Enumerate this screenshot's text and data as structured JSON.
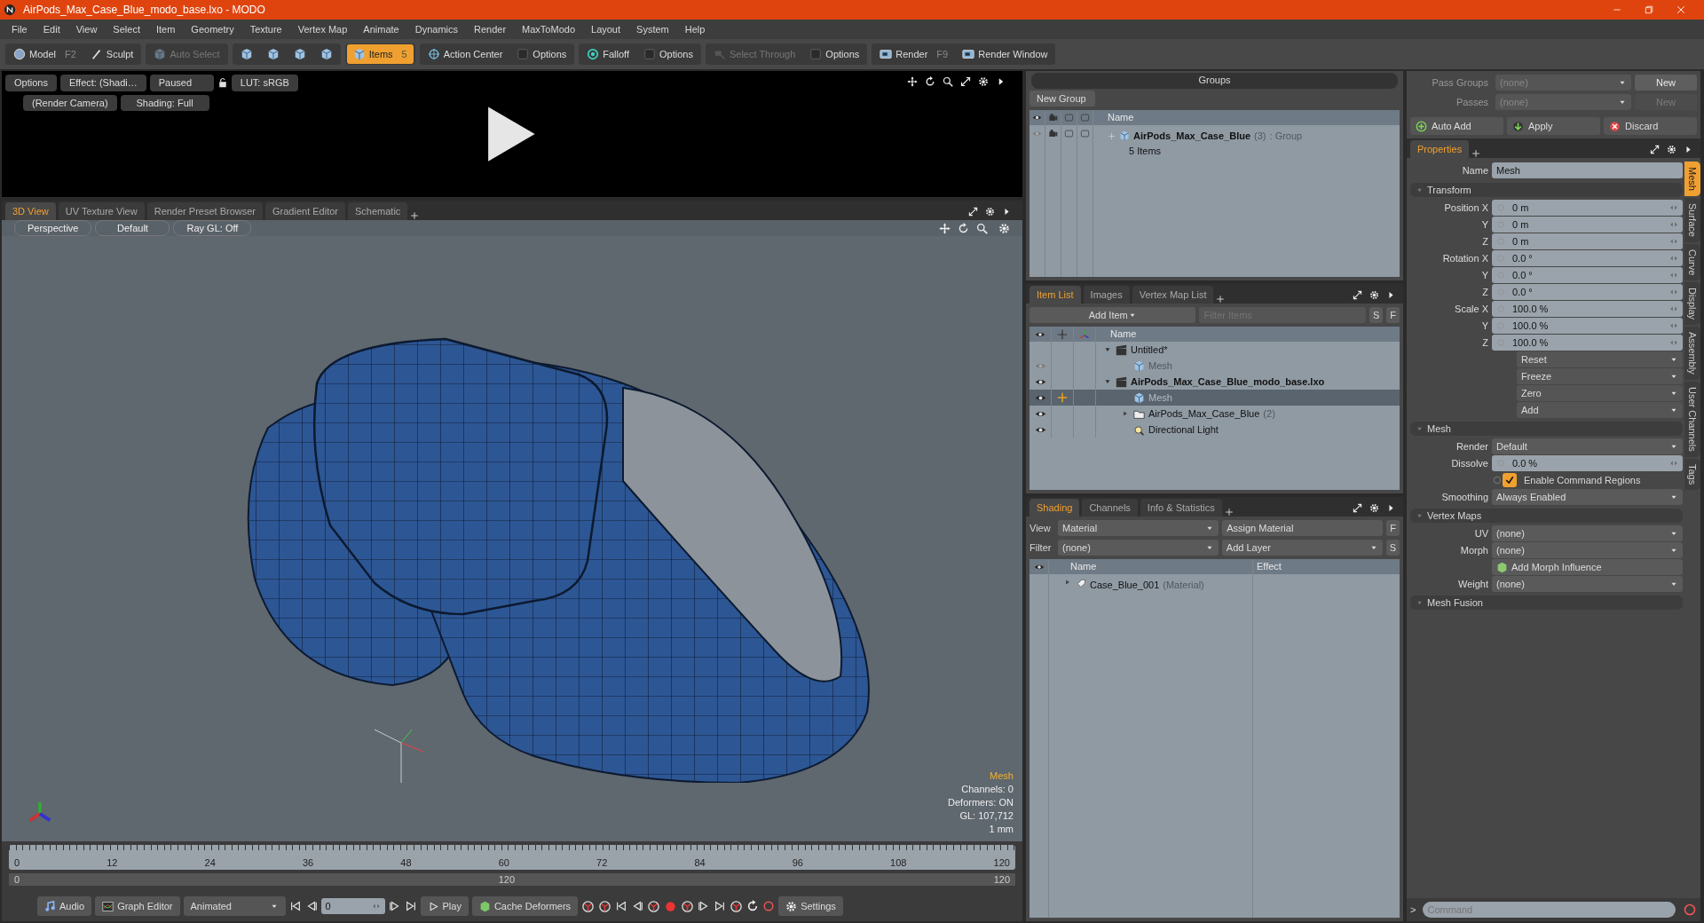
{
  "window": {
    "title": "AirPods_Max_Case_Blue_modo_base.lxo - MODO"
  },
  "menu": [
    "File",
    "Edit",
    "View",
    "Select",
    "Item",
    "Geometry",
    "Texture",
    "Vertex Map",
    "Animate",
    "Dynamics",
    "Render",
    "MaxToModo",
    "Layout",
    "System",
    "Help"
  ],
  "toolbar": [
    [
      {
        "kind": "sphere",
        "label": "Model",
        "shortcut": "F2",
        "selected": false,
        "disabled": false
      },
      {
        "kind": "brush",
        "label": "Sculpt",
        "selected": false,
        "disabled": false
      }
    ],
    [
      {
        "kind": "cube",
        "label": "Auto Select",
        "selected": false,
        "disabled": true
      }
    ],
    [
      {
        "kind": "cube",
        "selected": false,
        "disabled": false
      },
      {
        "kind": "cube",
        "selected": false,
        "disabled": false
      },
      {
        "kind": "cube",
        "selected": false,
        "disabled": false
      },
      {
        "kind": "cube",
        "selected": false,
        "disabled": false
      }
    ],
    [
      {
        "kind": "cube",
        "label": "Items",
        "shortcut": "5",
        "selected": true,
        "disabled": false
      }
    ],
    [
      {
        "kind": "target",
        "label": "Action Center",
        "selected": false,
        "disabled": false
      },
      {
        "kind": "check",
        "label": "Options",
        "selected": false,
        "disabled": false
      }
    ],
    [
      {
        "kind": "ring",
        "label": "Falloff",
        "selected": false,
        "disabled": false
      },
      {
        "kind": "check",
        "label": "Options",
        "selected": false,
        "disabled": false
      }
    ],
    [
      {
        "kind": "select",
        "label": "Select Through",
        "selected": false,
        "disabled": true
      },
      {
        "kind": "check",
        "label": "Options",
        "selected": false,
        "disabled": false
      }
    ],
    [
      {
        "kind": "render",
        "label": "Render",
        "shortcut": "F9",
        "selected": false,
        "disabled": false
      },
      {
        "kind": "render",
        "label": "Render Window",
        "selected": false,
        "disabled": false
      }
    ]
  ],
  "preview": {
    "row1": [
      "Options",
      "Effect: (Shadi…",
      "Paused",
      "LUT: sRGB"
    ],
    "row2": [
      "(Render Camera)",
      "Shading: Full"
    ]
  },
  "viewport": {
    "tabs": [
      {
        "label": "3D View",
        "selected": true
      },
      {
        "label": "UV Texture View",
        "selected": false
      },
      {
        "label": "Render Preset Browser",
        "selected": false
      },
      {
        "label": "Gradient Editor",
        "selected": false
      },
      {
        "label": "Schematic",
        "selected": false
      }
    ],
    "buttons": [
      "Perspective",
      "Default",
      "Ray GL: Off"
    ],
    "info_title": "Mesh",
    "info": [
      "Channels: 0",
      "Deformers: ON",
      "GL: 107,712",
      "1 mm"
    ]
  },
  "timeline": {
    "ticks": [
      "0",
      "12",
      "24",
      "36",
      "48",
      "60",
      "72",
      "84",
      "96",
      "108",
      "120"
    ],
    "range": [
      "0",
      "120",
      "120"
    ]
  },
  "transport": {
    "audio": "Audio",
    "graph_editor": "Graph Editor",
    "mode": "Animated",
    "frame": "0",
    "play": "Play",
    "cache": "Cache Deformers",
    "settings": "Settings"
  },
  "groups": {
    "title": "Groups",
    "new_button": "New Group",
    "column": "Name",
    "rows": [
      {
        "name": "AirPods_Max_Case_Blue",
        "count": "(3)",
        "type": ": Group",
        "detail": "5 Items"
      }
    ]
  },
  "passes": {
    "rows": [
      {
        "label": "Pass Groups",
        "value": "(none)",
        "button": "New",
        "disabled": false
      },
      {
        "label": "Passes",
        "value": "(none)",
        "button": "New",
        "disabled": true
      }
    ],
    "actions": [
      "Auto Add",
      "Apply",
      "Discard"
    ]
  },
  "item_list": {
    "tabs": [
      {
        "label": "Item List",
        "selected": true
      },
      {
        "label": "Images",
        "selected": false
      },
      {
        "label": "Vertex Map List",
        "selected": false
      }
    ],
    "add_button": "Add Item",
    "filter_placeholder": "Filter Items",
    "s_button": "S",
    "f_button": "F",
    "column": "Name",
    "items": [
      {
        "kind": "scene",
        "name": "Untitled*",
        "current": false,
        "greyed": false,
        "selected": false,
        "expanded": true,
        "children": [
          {
            "kind": "mesh",
            "name": "Mesh",
            "visible": false,
            "current": false,
            "greyed": true,
            "selected": false
          }
        ]
      },
      {
        "kind": "scene",
        "name": "AirPods_Max_Case_Blue_modo_base.lxo",
        "visible": true,
        "current": true,
        "greyed": false,
        "selected": false,
        "expanded": true,
        "children": [
          {
            "kind": "mesh",
            "name": "Mesh",
            "visible": true,
            "current": false,
            "greyed": true,
            "selected": true
          },
          {
            "kind": "group",
            "name": "AirPods_Max_Case_Blue",
            "count": "(2)",
            "visible": true,
            "current": false,
            "greyed": false,
            "selected": false,
            "expanded": false
          },
          {
            "kind": "light",
            "name": "Directional Light",
            "visible": true,
            "current": false,
            "greyed": false,
            "selected": false
          }
        ]
      }
    ]
  },
  "shading": {
    "tabs": [
      {
        "label": "Shading",
        "selected": true
      },
      {
        "label": "Channels",
        "selected": false
      },
      {
        "label": "Info & Statistics",
        "selected": false
      }
    ],
    "view_label": "View",
    "view_value": "Material",
    "assign": "Assign Material",
    "f_button": "F",
    "filter_label": "Filter",
    "filter_value": "(none)",
    "add_layer": "Add Layer",
    "s_button": "S",
    "columns": [
      "Name",
      "Effect"
    ],
    "rows": [
      {
        "name": "Case_Blue_001",
        "type": "(Material)"
      }
    ]
  },
  "properties": {
    "tabs": [
      {
        "label": "Properties",
        "selected": true
      }
    ],
    "name_label": "Name",
    "name_value": "Mesh",
    "sections": [
      {
        "title": "Transform",
        "rows": [
          {
            "kind": "field",
            "label": "Position X",
            "value": "0 m"
          },
          {
            "kind": "field",
            "label": "Y",
            "value": "0 m"
          },
          {
            "kind": "field",
            "label": "Z",
            "value": "0 m"
          },
          {
            "kind": "field",
            "label": "Rotation X",
            "value": "0.0 °"
          },
          {
            "kind": "field",
            "label": "Y",
            "value": "0.0 °"
          },
          {
            "kind": "field",
            "label": "Z",
            "value": "0.0 °"
          },
          {
            "kind": "field",
            "label": "Scale X",
            "value": "100.0 %"
          },
          {
            "kind": "field",
            "label": "Y",
            "value": "100.0 %"
          },
          {
            "kind": "field",
            "label": "Z",
            "value": "100.0 %"
          },
          {
            "kind": "menu",
            "value": "Reset"
          },
          {
            "kind": "menu",
            "value": "Freeze"
          },
          {
            "kind": "menu",
            "value": "Zero"
          },
          {
            "kind": "menu",
            "value": "Add"
          }
        ]
      },
      {
        "title": "Mesh",
        "rows": [
          {
            "kind": "dropdown",
            "label": "Render",
            "value": "Default"
          },
          {
            "kind": "field",
            "label": "Dissolve",
            "value": "0.0 %"
          },
          {
            "kind": "check",
            "value": "Enable Command Regions",
            "checked": true
          },
          {
            "kind": "dropdown",
            "label": "Smoothing",
            "value": "Always Enabled"
          }
        ]
      },
      {
        "title": "Vertex Maps",
        "rows": [
          {
            "kind": "dropdown",
            "label": "UV",
            "value": "(none)"
          },
          {
            "kind": "dropdown",
            "label": "Morph",
            "value": "(none)"
          },
          {
            "kind": "button",
            "value": "Add Morph Influence"
          },
          {
            "kind": "dropdown",
            "label": "Weight",
            "value": "(none)"
          }
        ]
      },
      {
        "title": "Mesh Fusion"
      }
    ],
    "side_tabs": [
      {
        "label": "Mesh",
        "selected": true
      },
      {
        "label": "Surface",
        "selected": false
      },
      {
        "label": "Curve",
        "selected": false
      },
      {
        "label": "Display",
        "selected": false
      },
      {
        "label": "Assembly",
        "selected": false
      },
      {
        "label": "User Channels",
        "selected": false
      },
      {
        "label": "Tags",
        "selected": false
      }
    ]
  },
  "command": {
    "prompt": ">",
    "placeholder": "Command"
  }
}
